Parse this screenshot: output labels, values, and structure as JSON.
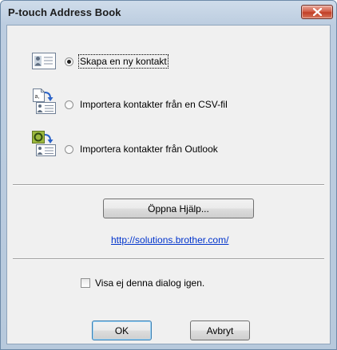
{
  "window": {
    "title": "P-touch Address Book"
  },
  "options": [
    {
      "label": "Skapa en ny kontakt",
      "selected": true,
      "icon": "contact-card-icon"
    },
    {
      "label": "Importera kontakter från en CSV-fil",
      "selected": false,
      "icon": "csv-import-icon"
    },
    {
      "label": "Importera kontakter från Outlook",
      "selected": false,
      "icon": "outlook-import-icon"
    }
  ],
  "help": {
    "button_label": "Öppna Hjälp...",
    "url_label": "http://solutions.brother.com/"
  },
  "dont_show": {
    "label": "Visa ej denna dialog igen.",
    "checked": false
  },
  "footer": {
    "ok_label": "OK",
    "cancel_label": "Avbryt"
  },
  "colors": {
    "title_bar": "#bccde0",
    "client_bg": "#f0f0f0",
    "close_button": "#c13f26",
    "link": "#0033cc"
  }
}
